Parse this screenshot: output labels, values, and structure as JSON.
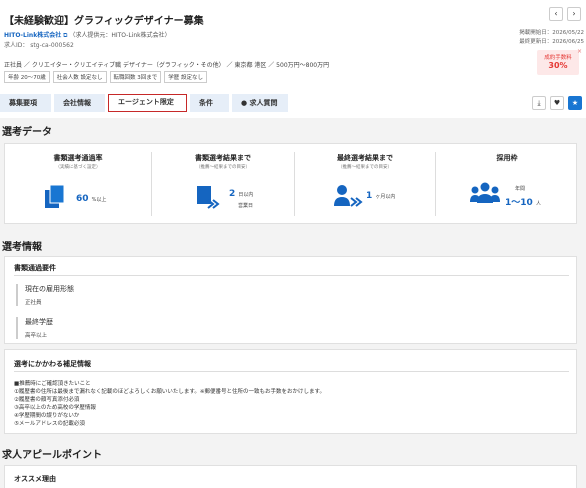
{
  "header": {
    "title": "【未経験歓迎】グラフィックデザイナー募集",
    "prev_icon": "‹",
    "next_icon": "›",
    "company_name": "HITO-Link株式会社",
    "company_note": "（求人提供元：HITO-Link株式会社）",
    "job_id": "求人ID： stg-ca-000562",
    "published": "掲載開始日：2026/05/22",
    "updated": "最終更新日：2026/06/25",
    "meta": "正社員 ／ クリエイター・クリエイティブ職 デザイナー（グラフィック・その他） ／ 東京都 港区 ／ 500万円〜800万円",
    "tags": [
      "年齢 20〜70歳",
      "社会人数 設定なし",
      "転職回数 3回まで",
      "学歴 設定なし"
    ],
    "fee_label": "成約手数料",
    "fee_value": "30%"
  },
  "tabs": [
    "募集要項",
    "会社情報",
    "エージェント限定",
    "条件",
    "求人質問"
  ],
  "active_tab": 2,
  "colors": {
    "accent": "#1565c0",
    "active_border": "#c62828",
    "fee": "#e53935"
  },
  "selection": {
    "heading": "選考データ",
    "stats": [
      {
        "title": "書類選考通過率",
        "sub": "（実績に基づく設定）",
        "value": "60",
        "unit": "%以上",
        "icon": "documents-icon"
      },
      {
        "title": "書類選考結果まで",
        "sub": "（推薦〜結果までの目安）",
        "value": "2",
        "unit": "日以内",
        "unit2": "営業日",
        "icon": "document-forward-icon"
      },
      {
        "title": "最終選考結果まで",
        "sub": "（推薦〜結果までの目安）",
        "value": "1",
        "unit": "ヶ月以内",
        "icon": "person-forward-icon"
      },
      {
        "title": "採用枠",
        "sub": "",
        "label": "年間",
        "value": "1〜10",
        "unit": "人",
        "icon": "group-icon"
      }
    ]
  },
  "info": {
    "heading": "選考情報",
    "card1_title": "書類通過要件",
    "req1_name": "現在の雇用形態",
    "req1_value": "正社員",
    "req2_name": "最終学歴",
    "req2_value": "高卒以上",
    "card2_title": "選考にかかわる補足情報",
    "notes": [
      "■推薦時にご確認頂きたいこと",
      "①履歴書の住所は最後まで漏れなく記載のほどよろしくお願いいたします。※郵便番号と住所の一致もお手数をおかけします。",
      "②履歴書の顔写真添付必須",
      "③高卒以上のため高校の学歴情報",
      "④学歴期間の誤りがないか",
      "⑤メールアドレスの記載必須"
    ]
  },
  "appeal": {
    "heading": "求人アピールポイント",
    "card_title": "オススメ理由"
  }
}
